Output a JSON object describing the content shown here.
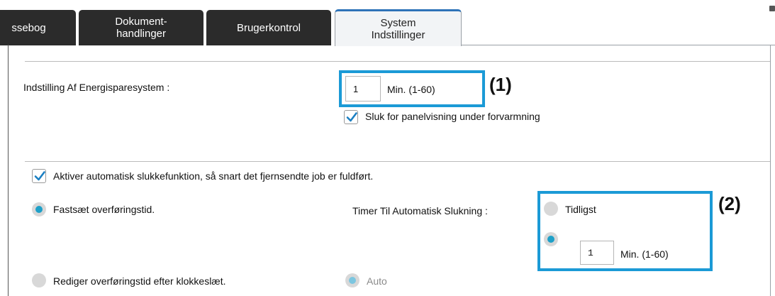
{
  "tabs": [
    {
      "label": "ssebog"
    },
    {
      "line1": "Dokument-",
      "line2": "handlinger"
    },
    {
      "label": "Brugerkontrol"
    },
    {
      "line1": "System",
      "line2": "Indstillinger"
    }
  ],
  "energy": {
    "label": "Indstilling Af Energisparesystem :",
    "minutes_value": "1",
    "minutes_unit": "Min. (1-60)",
    "panel_off_label": "Sluk for panelvisning under forvarmning",
    "panel_off_checked": true
  },
  "callouts": {
    "first": "(1)",
    "second": "(2)"
  },
  "auto_power": {
    "checkbox_label": "Aktiver automatisk slukkefunktion, så snart det fjernsendte job er fuldført.",
    "checked": true,
    "fixed_time_label": "Fastsæt overføringstid.",
    "timer_label": "Timer Til Automatisk Slukning :",
    "earliest_label": "Tidligst",
    "minutes_value": "1",
    "minutes_unit": "Min. (1-60)",
    "edit_by_clock_label": "Rediger overføringstid efter klokkeslæt.",
    "auto_label": "Auto"
  },
  "colors": {
    "accent": "#1b9ad6",
    "tab_dark": "#2b2b2b",
    "radio_selected": "#1ea0c8"
  }
}
